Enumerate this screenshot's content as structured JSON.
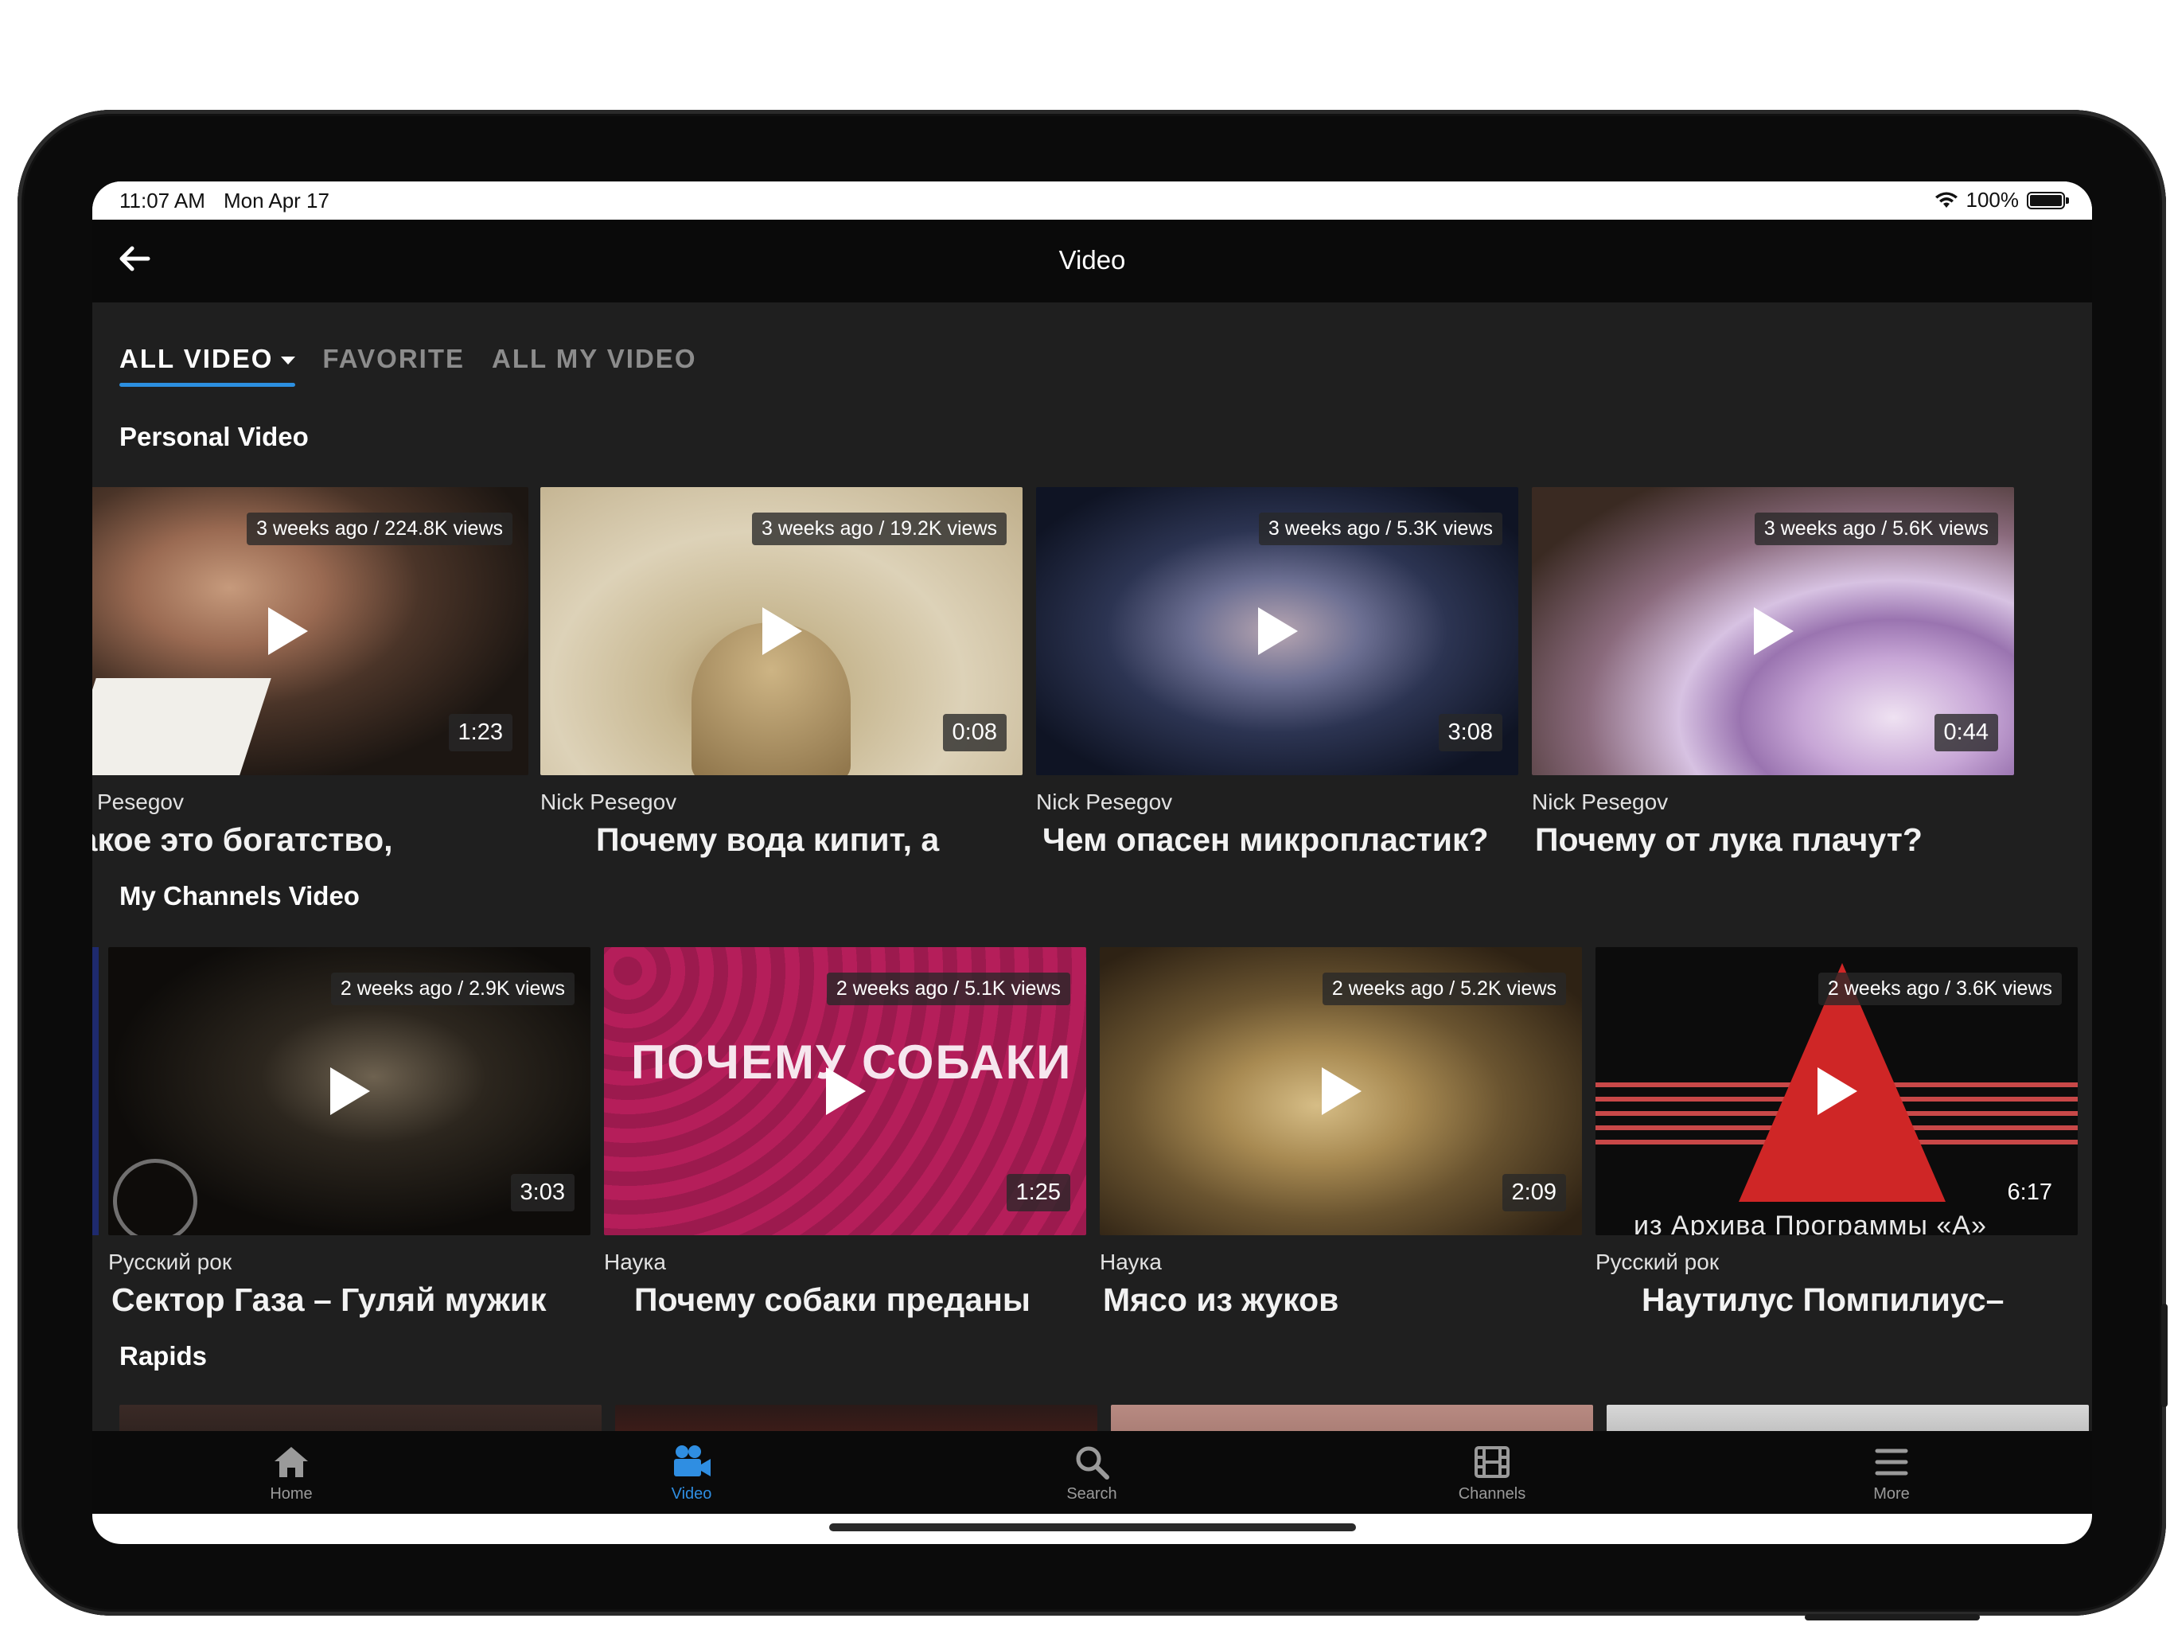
{
  "status_bar": {
    "time": "11:07 AM",
    "date": "Mon Apr 17",
    "battery": "100%"
  },
  "header": {
    "title": "Video"
  },
  "tabs": [
    {
      "label": "ALL VIDEO",
      "active": true
    },
    {
      "label": "FAVORITE",
      "active": false
    },
    {
      "label": "ALL MY VIDEO",
      "active": false
    }
  ],
  "sections": {
    "personal": {
      "title": "Personal Video",
      "videos": [
        {
          "meta": "3 weeks ago / 224.8K views",
          "duration": "1:23",
          "channel": "Pesegov",
          "title": "' какое это богатство,",
          "thumb_colors": [
            "#2a2018",
            "#b98a6c",
            "#4b3a30"
          ]
        },
        {
          "meta": "3 weeks ago / 19.2K views",
          "duration": "0:08",
          "channel": "Nick Pesegov",
          "title": "Почему вода кипит, а",
          "thumb_colors": [
            "#cfc2a4",
            "#a8926a",
            "#e2d8c0"
          ]
        },
        {
          "meta": "3 weeks ago / 5.3K views",
          "duration": "3:08",
          "channel": "Nick Pesegov",
          "title": "Чем опасен микропластик?",
          "thumb_colors": [
            "#141a2c",
            "#5b6a8e",
            "#9c8a9a"
          ]
        },
        {
          "meta": "3 weeks ago / 5.6K views",
          "duration": "0:44",
          "channel": "Nick Pesegov",
          "title": "Почему от лука плачут?",
          "thumb_colors": [
            "#3b2a1e",
            "#b592c8",
            "#e6d6ee"
          ]
        }
      ]
    },
    "channels": {
      "title": "My Channels Video",
      "videos": [
        {
          "meta": "2 weeks ago / 2.9K views",
          "duration": "3:03",
          "channel": "Русский рок",
          "title": "Сектор Газа – Гуляй мужик",
          "thumb_colors": [
            "#0e0c0a",
            "#3a332a",
            "#8a7e6a"
          ]
        },
        {
          "meta": "2 weeks ago / 5.1K views",
          "duration": "1:25",
          "channel": "Наука",
          "title": "Почему собаки преданы",
          "overlay_text": "ПОЧЕМУ СОБАКИ",
          "thumb_colors": [
            "#b51e5a",
            "#8e1848",
            "#cf3a72"
          ]
        },
        {
          "meta": "2 weeks ago / 5.2K views",
          "duration": "2:09",
          "channel": "Наука",
          "title": "Мясо из жуков",
          "thumb_colors": [
            "#3a2a14",
            "#a98a52",
            "#d9c08a"
          ]
        },
        {
          "meta": "2 weeks ago / 3.6K views",
          "duration": "6:17",
          "channel": "Русский рок",
          "title": "Наутилус Помпилиус–",
          "caption": "из Архива Программы «А»",
          "thumb_colors": [
            "#0c0c0c",
            "#d02828",
            "#7a1010"
          ]
        }
      ]
    },
    "rapids": {
      "title": "Rapids"
    }
  },
  "tab_bar": [
    {
      "label": "Home",
      "icon": "home-icon",
      "active": false
    },
    {
      "label": "Video",
      "icon": "video-camera-icon",
      "active": true
    },
    {
      "label": "Search",
      "icon": "search-icon",
      "active": false
    },
    {
      "label": "Channels",
      "icon": "film-icon",
      "active": false
    },
    {
      "label": "More",
      "icon": "menu-icon",
      "active": false
    }
  ],
  "colors": {
    "accent": "#2f8ee2",
    "background": "#1f1f1f",
    "bar": "#0a0a0a"
  }
}
